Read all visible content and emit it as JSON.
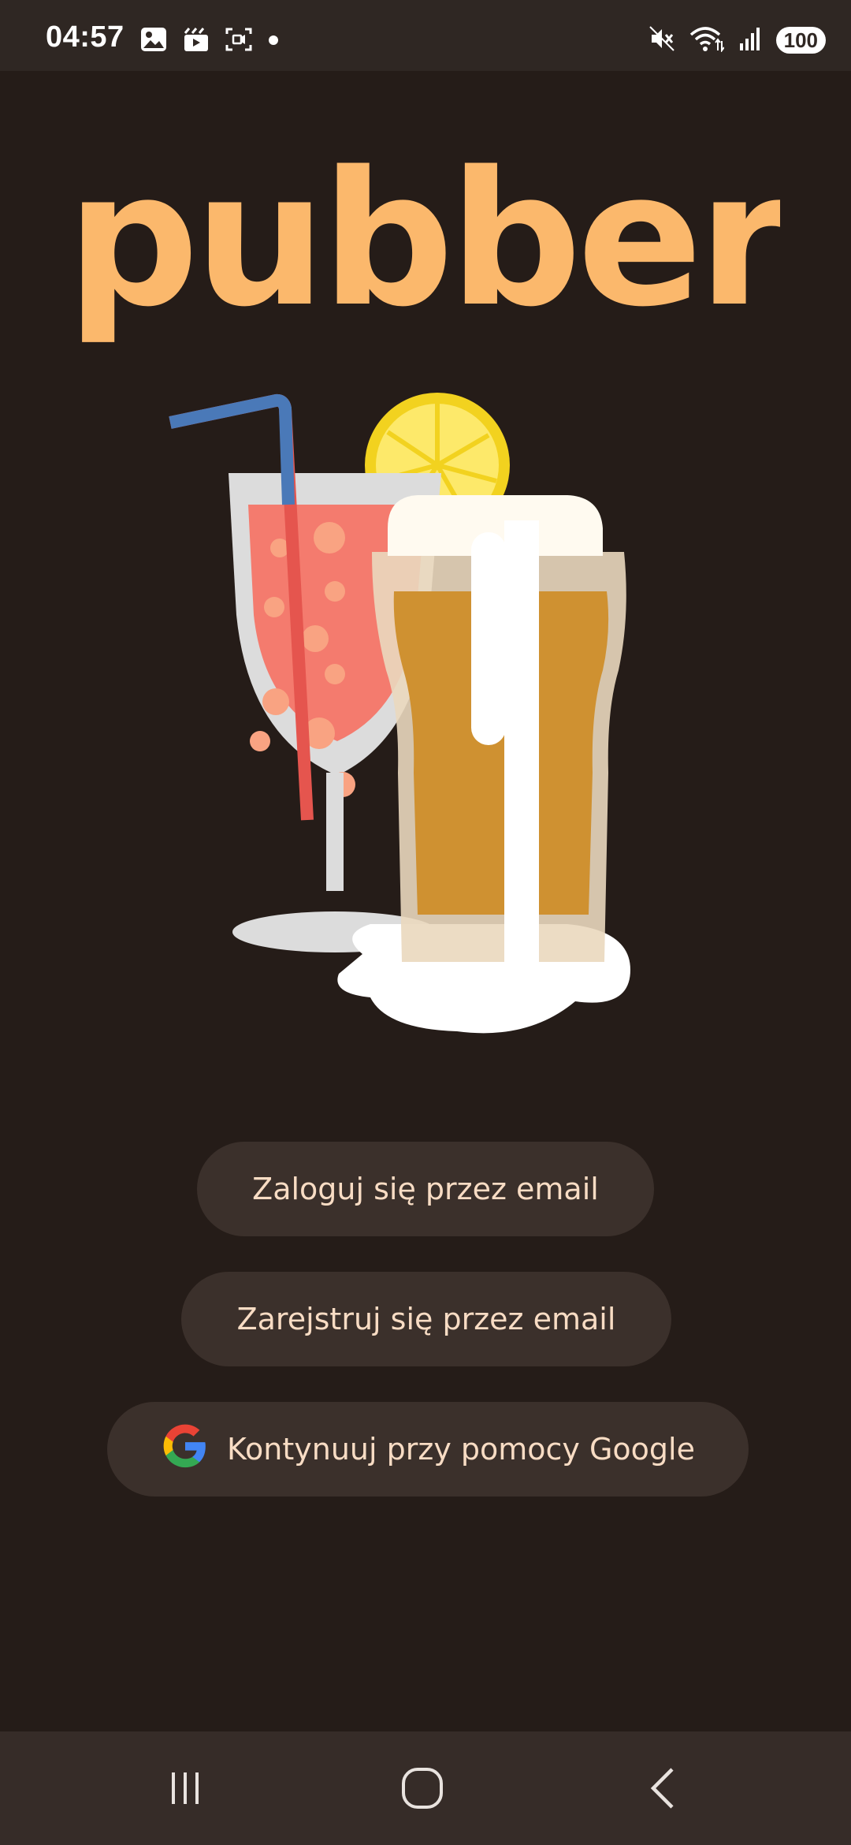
{
  "status_bar": {
    "time": "04:57",
    "battery": "100",
    "left_icons": [
      "gallery-icon",
      "media-icon",
      "screen-record-icon",
      "notification-dot-icon"
    ],
    "right_icons": [
      "mute-icon",
      "wifi-icon",
      "signal-icon",
      "battery-icon"
    ]
  },
  "app": {
    "logo_text": "pubber"
  },
  "buttons": {
    "login_email": "Zaloguj się przez email",
    "register_email": "Zarejstruj się przez email",
    "google": "Kontynuuj przy pomocy Google"
  },
  "navigation": {
    "icons": [
      "recent-apps-icon",
      "home-icon",
      "back-icon"
    ]
  },
  "colors": {
    "background": "#251c18",
    "button_bg": "#3b302b",
    "button_text": "#f8dcc4",
    "logo": "#fbb86c",
    "status_bar": "#2f2723",
    "nav_bar": "#362c28"
  }
}
